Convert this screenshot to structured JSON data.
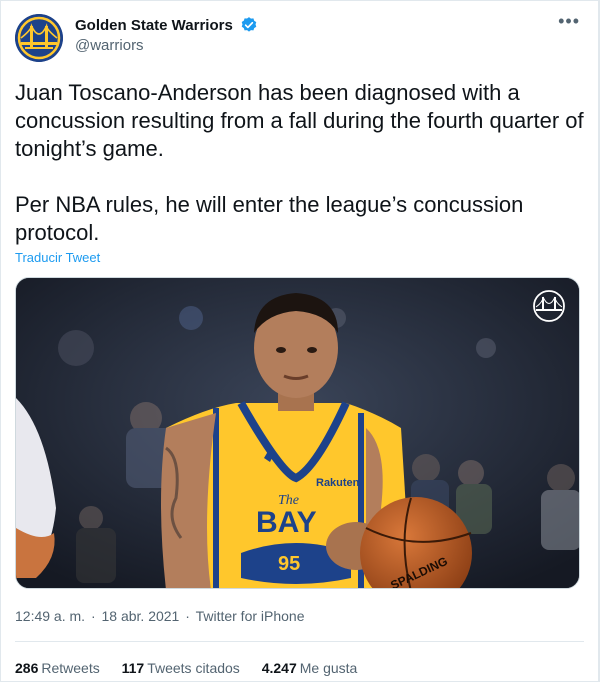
{
  "account": {
    "display_name": "Golden State Warriors",
    "handle": "@warriors",
    "verified": true,
    "avatar_icon": "warriors-bridge-logo-icon"
  },
  "menu": {
    "more_label": "•••"
  },
  "tweet": {
    "text": "Juan Toscano-Anderson has been diagnosed with a concussion resulting from a fall during the fourth quarter of tonight’s game.\n\nPer NBA rules, he will enter the league’s concussion protocol.",
    "translate_label": "Traducir Tweet",
    "media": {
      "alt": "Juan Toscano-Anderson photo",
      "jersey_top": "The",
      "jersey_word": "BAY",
      "jersey_number": "95",
      "sponsor": "Rakuten",
      "ball_text": "SPALDING",
      "overlay_icon": "warriors-bridge-logo-icon"
    }
  },
  "meta": {
    "time": "12:49 a. m.",
    "separator": "·",
    "date": "18 abr. 2021",
    "source": "Twitter for iPhone"
  },
  "stats": {
    "retweets_count": "286",
    "retweets_label": "Retweets",
    "quotes_count": "117",
    "quotes_label": "Tweets citados",
    "likes_count": "4.247",
    "likes_label": "Me gusta"
  },
  "colors": {
    "brand_blue": "#1d428a",
    "brand_gold": "#ffc72c",
    "link": "#1d9bf0",
    "verified": "#1d9bf0",
    "muted_text": "#536471"
  }
}
